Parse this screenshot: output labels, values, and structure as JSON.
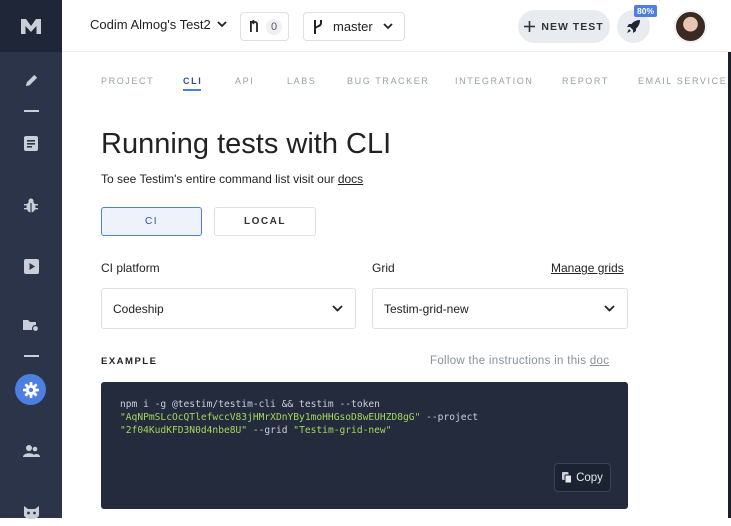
{
  "header": {
    "project_name": "Codim Almog's Test2",
    "pr_count": "0",
    "branch": "master",
    "new_test_label": "NEW TEST",
    "rocket_badge": "80%"
  },
  "tabs": [
    {
      "label": "PROJECT"
    },
    {
      "label": "CLI"
    },
    {
      "label": "API"
    },
    {
      "label": "LABS"
    },
    {
      "label": "BUG TRACKER"
    },
    {
      "label": "INTEGRATION"
    },
    {
      "label": "REPORT"
    },
    {
      "label": "EMAIL SERVICE"
    }
  ],
  "main": {
    "title": "Running tests with CLI",
    "subtitle_prefix": "To see Testim's entire command list visit our ",
    "subtitle_link": "docs",
    "ci_button": "CI",
    "local_button": "LOCAL",
    "ci_platform_label": "CI platform",
    "ci_platform_value": "Codeship",
    "grid_label": "Grid",
    "manage_grids": "Manage grids",
    "grid_value": "Testim-grid-new",
    "example_label": "EXAMPLE",
    "follow_prefix": "Follow the instructions in this ",
    "follow_link": "doc",
    "code": {
      "l1": "npm i -g @testim/testim-cli && testim --token",
      "token": "\"AqNPmSLcOcQTlefwccV83jHMrXDnYBy1moHHGsoD8wEUHZD8gG\"",
      "project_flag": " --project",
      "project_id": "\"2f04KudKFD3N0d4nbe8U\"",
      "grid_flag": " --grid ",
      "grid_name": "\"Testim-grid-new\""
    },
    "copy_label": "Copy"
  },
  "colors": {
    "sidebar": "#2b3448",
    "accent": "#4c7fe0",
    "code_bg": "#232b3c",
    "code_string": "#a4d65e"
  },
  "icons": {
    "sidebar": [
      "pencil-icon",
      "list-icon",
      "bug-icon",
      "play-icon",
      "folder-settings-icon",
      "gear-icon",
      "users-icon",
      "mask-icon"
    ]
  }
}
